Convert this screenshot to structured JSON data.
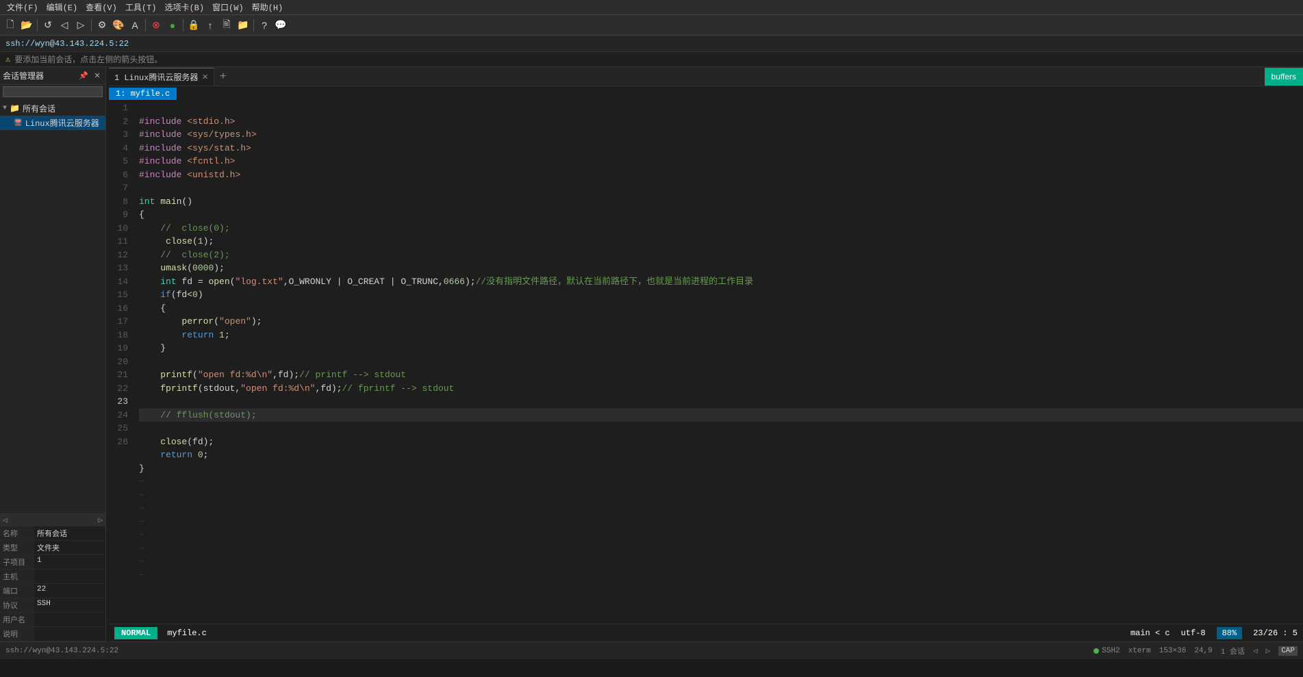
{
  "menu": {
    "items": [
      "文件(F)",
      "编辑(E)",
      "查看(V)",
      "工具(T)",
      "选项卡(B)",
      "窗口(W)",
      "帮助(H)"
    ]
  },
  "address_bar": {
    "text": "ssh://wyn@43.143.224.5:22"
  },
  "notification": {
    "text": "要添加当前会话，点击左侧的箭头按钮。"
  },
  "sidebar": {
    "title": "会话管理器",
    "pin_icon": "📌",
    "close_icon": "✕",
    "all_sessions_label": "所有会话",
    "server_item": "Linux腾讯云服务器",
    "props": [
      {
        "key": "名称",
        "value": "所有会话"
      },
      {
        "key": "类型",
        "value": "文件夹"
      },
      {
        "key": "子项目",
        "value": "1"
      },
      {
        "key": "主机",
        "value": ""
      },
      {
        "key": "端口",
        "value": "22"
      },
      {
        "key": "协议",
        "value": "SSH"
      },
      {
        "key": "用户名",
        "value": ""
      },
      {
        "key": "说明",
        "value": ""
      }
    ]
  },
  "tabs": [
    {
      "label": "1 Linux腾讯云服务器",
      "active": true
    }
  ],
  "tab_add_label": "+",
  "buffers_label": "buffers",
  "file_label": "1: myfile.c",
  "code": {
    "lines": [
      {
        "num": 1,
        "content": "#include <stdio.h>",
        "type": "include"
      },
      {
        "num": 2,
        "content": "#include <sys/types.h>",
        "type": "include"
      },
      {
        "num": 3,
        "content": "#include <sys/stat.h>",
        "type": "include"
      },
      {
        "num": 4,
        "content": "#include <fcntl.h>",
        "type": "include"
      },
      {
        "num": 5,
        "content": "#include <unistd.h>",
        "type": "include"
      },
      {
        "num": 6,
        "content": "",
        "type": "empty"
      },
      {
        "num": 7,
        "content": "int main()",
        "type": "func_decl"
      },
      {
        "num": 8,
        "content": "{",
        "type": "normal"
      },
      {
        "num": 9,
        "content": "    //  close(0);",
        "type": "comment"
      },
      {
        "num": 10,
        "content": "     close(1);",
        "type": "normal"
      },
      {
        "num": 11,
        "content": "    //  close(2);",
        "type": "comment"
      },
      {
        "num": 12,
        "content": "    umask(0000);",
        "type": "normal"
      },
      {
        "num": 13,
        "content": "    int fd = open(\"log.txt\",O_WRONLY | O_CREAT | O_TRUNC,0666);//没有指明文件路径，默认在当前路径下，也就是当前进程的工作目录",
        "type": "normal"
      },
      {
        "num": 14,
        "content": "    if(fd<0)",
        "type": "normal"
      },
      {
        "num": 15,
        "content": "    {",
        "type": "normal"
      },
      {
        "num": 16,
        "content": "        perror(\"open\");",
        "type": "normal"
      },
      {
        "num": 17,
        "content": "        return 1;",
        "type": "normal"
      },
      {
        "num": 18,
        "content": "    }",
        "type": "normal"
      },
      {
        "num": 19,
        "content": "",
        "type": "empty"
      },
      {
        "num": 20,
        "content": "    printf(\"open fd:%d\\n\",fd);// printf --> stdout",
        "type": "normal"
      },
      {
        "num": 21,
        "content": "    fprintf(stdout,\"open fd:%d\\n\",fd);// fprintf --> stdout",
        "type": "normal"
      },
      {
        "num": 22,
        "content": "",
        "type": "empty"
      },
      {
        "num": 23,
        "content": "    // fflush(stdout);",
        "type": "comment_hl"
      },
      {
        "num": 24,
        "content": "    close(fd);",
        "type": "normal"
      },
      {
        "num": 25,
        "content": "    return 0;",
        "type": "normal"
      },
      {
        "num": 26,
        "content": "}",
        "type": "normal"
      }
    ],
    "tilde_lines": 8
  },
  "status_bar": {
    "mode": "NORMAL",
    "file": "myfile.c",
    "func_info": "main < c",
    "encoding": "utf-8",
    "percent": "88%",
    "position": "23/26 :  5"
  },
  "bottom_bar": {
    "ssh_address": "ssh://wyn@43.143.224.5:22",
    "protocol": "SSH2",
    "terminal": "xterm",
    "dimensions": "153×36",
    "cursor": "24,9",
    "sessions": "1 会话",
    "cap": "CAP"
  }
}
